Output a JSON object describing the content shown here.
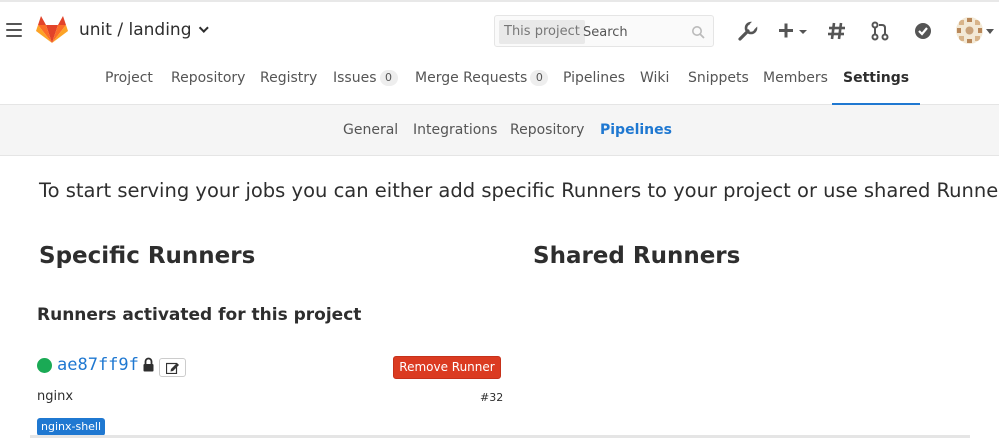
{
  "header": {
    "namespace": "unit",
    "separator": "/",
    "project": "landing",
    "search": {
      "scope": "This project",
      "placeholder": "Search"
    },
    "icons": [
      "hamburger-icon",
      "gitlab-logo",
      "wrench-icon",
      "plus-icon",
      "hash-icon",
      "merge-request-icon",
      "todo-check-icon",
      "avatar"
    ]
  },
  "project_nav": {
    "tabs": [
      {
        "label": "Project"
      },
      {
        "label": "Repository"
      },
      {
        "label": "Registry"
      },
      {
        "label": "Issues",
        "count": "0"
      },
      {
        "label": "Merge Requests",
        "count": "0"
      },
      {
        "label": "Pipelines"
      },
      {
        "label": "Wiki"
      },
      {
        "label": "Snippets"
      },
      {
        "label": "Members"
      },
      {
        "label": "Settings",
        "active": true
      }
    ]
  },
  "settings_nav": {
    "tabs": [
      {
        "label": "General"
      },
      {
        "label": "Integrations"
      },
      {
        "label": "Repository"
      },
      {
        "label": "Pipelines",
        "active": true
      }
    ]
  },
  "content": {
    "intro": "To start serving your jobs you can either add specific Runners to your project or use shared Runners",
    "specific_heading": "Specific Runners",
    "shared_heading": "Shared Runners",
    "activated_heading": "Runners activated for this project",
    "runner": {
      "token": "ae87ff9f",
      "status": "online",
      "status_color": "#1aaa55",
      "remove_label": "Remove Runner",
      "description": "nginx",
      "id": "#32",
      "tags": [
        "nginx-shell"
      ]
    }
  },
  "colors": {
    "link_blue": "#1f78d1",
    "danger_red": "#db3b21",
    "online_green": "#1aaa55"
  }
}
